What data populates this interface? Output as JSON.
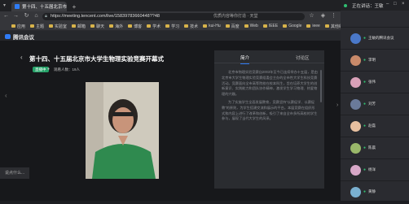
{
  "browser": {
    "tab_title": "第十四、十五届北京市大学生...",
    "url": "https://meeting.tencent.com/live/15839783660448??48",
    "search_placeholder": "优质内容等你打造 · 天堂",
    "bookmarks": [
      "应用",
      "主题",
      "实验室",
      "邮箱",
      "聊天",
      "海外",
      "博客",
      "学术",
      "学习",
      "技术",
      "kui-Hu",
      "百度",
      "Web",
      "IEEE",
      "Google",
      "ieee",
      "其他收藏"
    ]
  },
  "app": {
    "name": "腾讯会议",
    "meeting_title": "第十四、十五届北京市大学生物理实验竞赛开幕式",
    "live_label": "直播中",
    "viewers": "观看人数：19人",
    "tabs": [
      "简介",
      "讨论区"
    ],
    "intro_paragraphs": [
      "北京市物理实验竞赛自2003年至今已连续举办十五届，是由北京市大学生物理实验竞赛组委会主办的全市性大学生科技竞赛活动。竞赛面向全市高等院校在校本科生，旨在培养大学生的创新意识、实践能力和团队协作精神，激发学生学习物理、热爱物理的兴趣。",
      "为了实施学生全面发展教育，竞赛坚持“以赛促学、以赛促教”的原则，为学生搭建交流和展示的平台。本届竞赛在组织形式和内容上进行了改革和创新，吸引了来自全市多所高校的学生参与，展现了当代大学生的风采。"
    ],
    "chat_placeholder": "说点什么..."
  },
  "client": {
    "speaking": "正在讲话：王敏",
    "participants": [
      {
        "name": "王敏的腾讯会议",
        "avatar_color": "#4a78c9"
      },
      {
        "name": "李明",
        "avatar_color": "#c98a6a"
      },
      {
        "name": "张伟",
        "avatar_color": "#d9a1b8"
      },
      {
        "name": "刘芳",
        "avatar_color": "#6a7a9a"
      },
      {
        "name": "赵磊",
        "avatar_color": "#e8c0a0"
      },
      {
        "name": "陈晨",
        "avatar_color": "#9ab86a"
      },
      {
        "name": "杨洋",
        "avatar_color": "#d8a8c8"
      },
      {
        "name": "黄静",
        "avatar_color": "#7ab0d0"
      }
    ]
  }
}
